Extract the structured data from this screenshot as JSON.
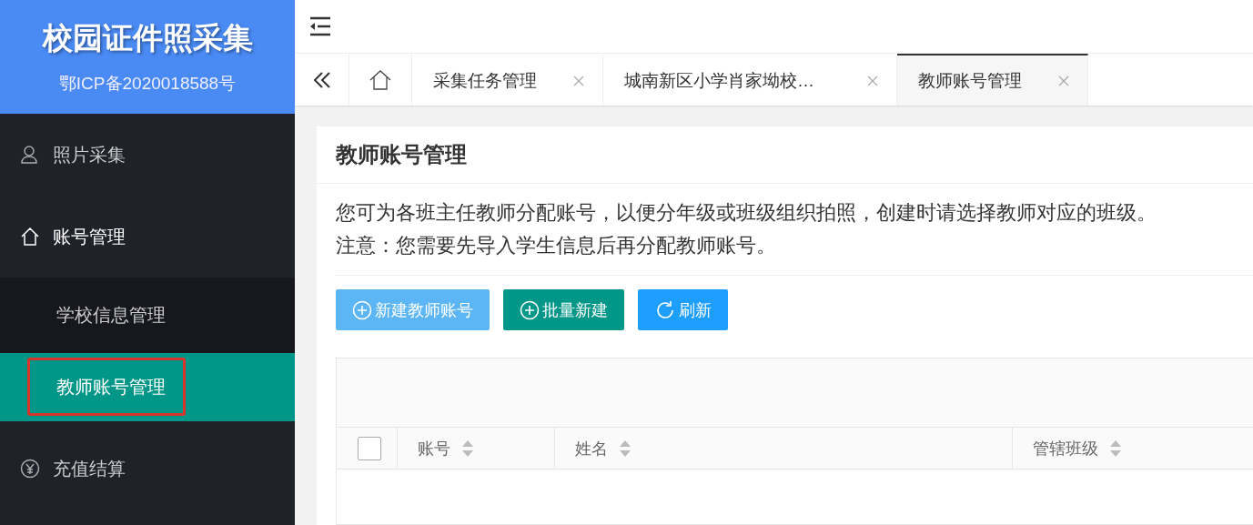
{
  "logo": {
    "title": "校园证件照采集",
    "subtitle": "鄂ICP备2020018588号"
  },
  "sidebar": {
    "items": [
      {
        "label": "照片采集",
        "expanded": false
      },
      {
        "label": "账号管理",
        "expanded": true,
        "children": [
          {
            "label": "学校信息管理",
            "selected": false,
            "highlighted": false
          },
          {
            "label": "教师账号管理",
            "selected": true,
            "highlighted": true
          }
        ]
      },
      {
        "label": "充值结算",
        "expanded": false
      }
    ]
  },
  "tabs": [
    {
      "label": "采集任务管理",
      "selected": false
    },
    {
      "label": "城南新区小学肖家坳校…",
      "selected": false
    },
    {
      "label": "教师账号管理",
      "selected": true
    }
  ],
  "card": {
    "title": "教师账号管理",
    "notes": [
      "您可为各班主任教师分配账号，以便分年级或班级组织拍照，创建时请选择教师对应的班级。",
      "注意：您需要先导入学生信息后再分配教师账号。"
    ],
    "buttons": [
      {
        "label": "新建教师账号",
        "kind": "add",
        "color": "#5cb5f5"
      },
      {
        "label": "批量新建",
        "kind": "add",
        "color": "#009688"
      },
      {
        "label": "刷新",
        "kind": "refresh",
        "color": "#1e9fff"
      }
    ],
    "table": {
      "select_all": {
        "checked": false
      },
      "columns": [
        {
          "label": "账号",
          "sortable": true
        },
        {
          "label": "姓名",
          "sortable": true
        },
        {
          "label": "管辖班级",
          "sortable": true
        }
      ]
    }
  }
}
